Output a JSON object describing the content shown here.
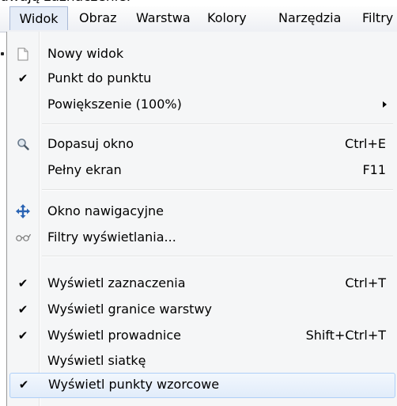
{
  "top_text": "dwają zaznaczenie.",
  "menubar": {
    "items": [
      {
        "label": "Widok"
      },
      {
        "label": "Obraz"
      },
      {
        "label": "Warstwa"
      },
      {
        "label": "Kolory"
      },
      {
        "label": "Narzędzia"
      },
      {
        "label": "Filtry"
      }
    ]
  },
  "menu": {
    "items": [
      {
        "label": "Nowy widok",
        "shortcut": "",
        "icon": "new-document-icon",
        "checked": false
      },
      {
        "label": "Punkt do punktu",
        "shortcut": "",
        "icon": "checkmark-icon",
        "checked": true
      },
      {
        "label": "Powiększenie (100%)",
        "shortcut": "",
        "icon": "",
        "submenu": true
      },
      {
        "label": "Dopasuj okno",
        "shortcut": "Ctrl+E",
        "icon": "zoom-icon"
      },
      {
        "label": "Pełny ekran",
        "shortcut": "F11",
        "icon": ""
      },
      {
        "label": "Okno nawigacyjne",
        "shortcut": "",
        "icon": "navigate-icon"
      },
      {
        "label": "Filtry wyświetlania...",
        "shortcut": "",
        "icon": "glasses-icon"
      },
      {
        "label": "Wyświetl zaznaczenia",
        "shortcut": "Ctrl+T",
        "icon": "checkmark-icon",
        "checked": true
      },
      {
        "label": "Wyświetl granice warstwy",
        "shortcut": "",
        "icon": "checkmark-icon",
        "checked": true
      },
      {
        "label": "Wyświetl prowadnice",
        "shortcut": "Shift+Ctrl+T",
        "icon": "checkmark-icon",
        "checked": true
      },
      {
        "label": "Wyświetl siatkę",
        "shortcut": "",
        "icon": "",
        "checked": false
      },
      {
        "label": "Wyświetl punkty wzorcowe",
        "shortcut": "",
        "icon": "checkmark-icon",
        "checked": true,
        "highlighted": true
      }
    ]
  },
  "colors": {
    "highlight_border": "#aecff7",
    "menu_background": "#f5f6f7",
    "navigate_icon": "#2a64b4"
  }
}
